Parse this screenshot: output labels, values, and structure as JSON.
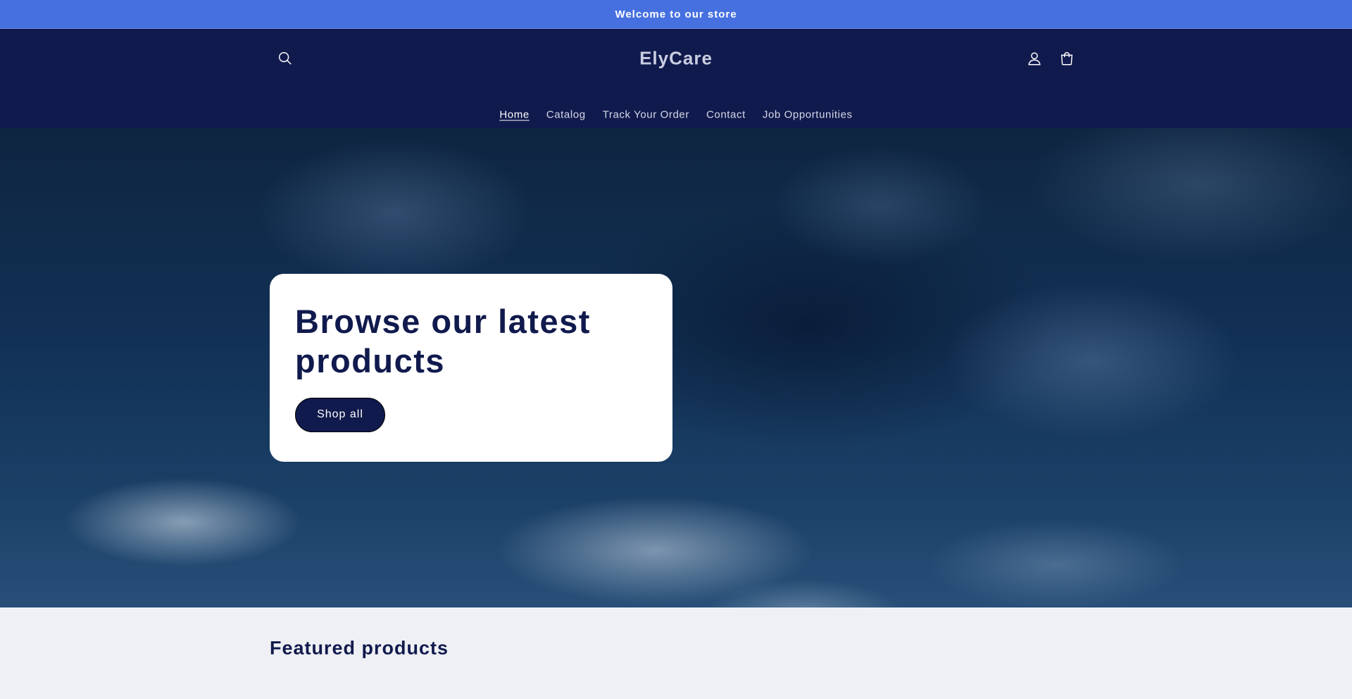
{
  "announcement": {
    "text": "Welcome to our store"
  },
  "header": {
    "logo": "ElyCare",
    "icons": {
      "search": "search-icon",
      "account": "user-icon",
      "cart": "cart-icon"
    }
  },
  "nav": {
    "items": [
      {
        "label": "Home",
        "active": true
      },
      {
        "label": "Catalog"
      },
      {
        "label": "Track Your Order"
      },
      {
        "label": "Contact"
      },
      {
        "label": "Job Opportunities"
      }
    ]
  },
  "hero": {
    "title": "Browse our latest products",
    "button": "Shop all"
  },
  "featured": {
    "title": "Featured products"
  },
  "colors": {
    "announcement_bg": "#4670e0",
    "header_bg": "#111a4d",
    "accent": "#111a4d",
    "page_bg": "#eff0f5"
  }
}
